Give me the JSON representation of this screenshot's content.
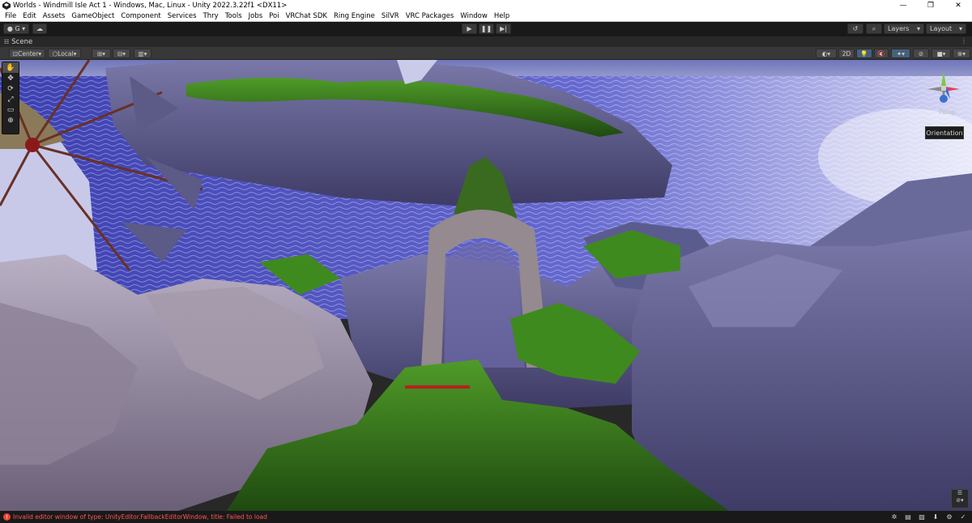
{
  "window": {
    "title": "Worlds - Windmill Isle Act 1 - Windows, Mac, Linux - Unity 2022.3.22f1 <DX11>",
    "minimize": "—",
    "maximize": "❐",
    "close": "✕"
  },
  "menu": [
    "File",
    "Edit",
    "Assets",
    "GameObject",
    "Component",
    "Services",
    "Thry",
    "Tools",
    "Jobs",
    "Poi",
    "VRChat SDK",
    "Ring Engine",
    "SilVR",
    "VRC Packages",
    "Window",
    "Help"
  ],
  "toolbar": {
    "account_label": "G",
    "layers_label": "Layers",
    "layout_label": "Layout"
  },
  "scene_tab": {
    "label": "Scene"
  },
  "scene_toolbar": {
    "pivot_label": "Center",
    "space_label": "Local",
    "mode_2d": "2D"
  },
  "gizmo": {
    "projection_label": "Persp"
  },
  "overlay": {
    "orientation_label": "Orientation"
  },
  "status": {
    "message": "Invalid editor window of type: UnityEditor.FallbackEditorWindow, title: Failed to load",
    "error_color": "#ff5555"
  },
  "colors": {
    "toolbar_bg": "#191919",
    "panel_bg": "#282828",
    "sea": "#4a4fbf",
    "sky": "#8b90c8",
    "grass": "#3c7a1a"
  }
}
